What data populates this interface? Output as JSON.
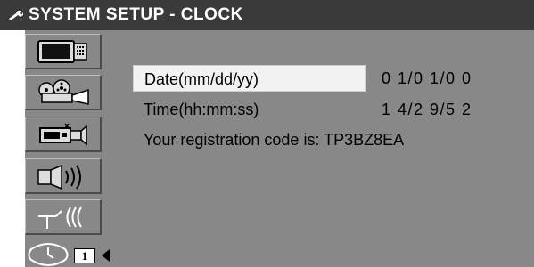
{
  "header": {
    "title": "SYSTEM SETUP - CLOCK",
    "icon": "wrench-icon"
  },
  "sidebar": {
    "items": [
      {
        "icon": "tv-monitor-icon",
        "label": ""
      },
      {
        "icon": "video-camera-icon",
        "label": ""
      },
      {
        "icon": "camcorder-icon",
        "label": ""
      },
      {
        "icon": "speaker-icon",
        "label": ""
      },
      {
        "icon": "antenna-icon",
        "label": ""
      },
      {
        "icon": "clock-icon",
        "label": ""
      }
    ],
    "page_number": "1"
  },
  "clock": {
    "date_label": "Date(mm/dd/yy)",
    "date_value": "0 1/0 1/0 0",
    "time_label": "Time(hh:mm:ss)",
    "time_value": "1 4/2 9/5 2",
    "registration_text": "Your registration code is: TP3BZ8EA"
  },
  "colors": {
    "title_bar": "#3a3a3a",
    "panel": "#888888",
    "highlight": "#f2f2f2"
  }
}
